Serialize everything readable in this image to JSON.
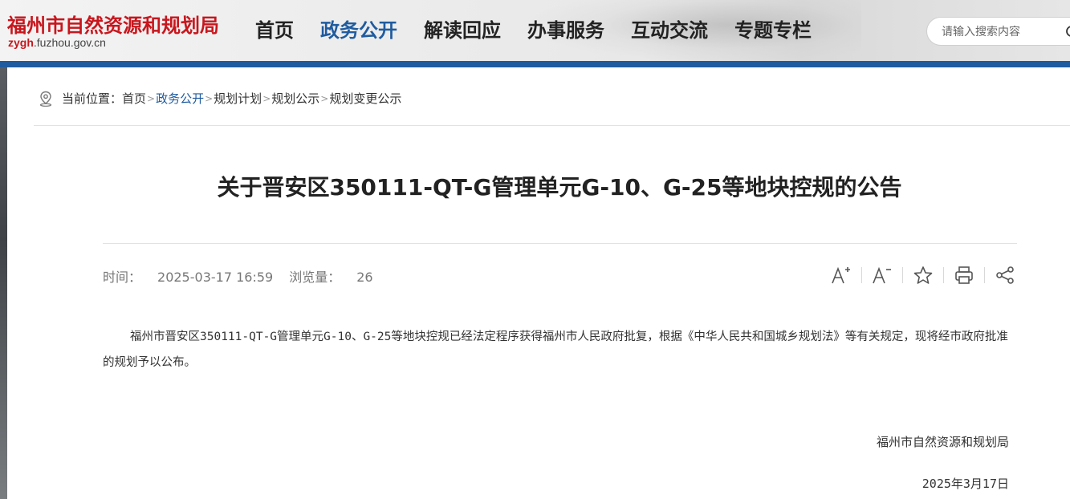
{
  "site": {
    "name_cn": "福州市自然资源和规划局",
    "domain_prefix": "zygh",
    "domain_suffix": ".fuzhou.gov.cn"
  },
  "nav": {
    "items": [
      {
        "label": "首页",
        "active": false
      },
      {
        "label": "政务公开",
        "active": true
      },
      {
        "label": "解读回应",
        "active": false
      },
      {
        "label": "办事服务",
        "active": false
      },
      {
        "label": "互动交流",
        "active": false
      },
      {
        "label": "专题专栏",
        "active": false
      }
    ]
  },
  "search": {
    "placeholder": "请输入搜索内容",
    "icon": "search-icon"
  },
  "breadcrumb": {
    "prefix": "当前位置：",
    "items": [
      {
        "label": "首页",
        "active": false
      },
      {
        "label": "政务公开",
        "active": true
      },
      {
        "label": "规划计划",
        "active": false
      },
      {
        "label": "规划公示",
        "active": false
      },
      {
        "label": "规划变更公示",
        "active": false
      }
    ],
    "separator": ">"
  },
  "article": {
    "title": "关于晋安区350111-QT-G管理单元G-10、G-25等地块控规的公告",
    "time_label": "时间：",
    "time": "2025-03-17 16:59",
    "views_label": "浏览量：",
    "views": "26",
    "body": "福州市晋安区350111-QT-G管理单元G-10、G-25等地块控规已经法定程序获得福州市人民政府批复，根据《中华人民共和国城乡规划法》等有关规定，现将经市政府批准的规划予以公布。",
    "sign_org": "福州市自然资源和规划局",
    "sign_date": "2025年3月17日"
  },
  "tools": [
    {
      "icon": "font-increase-icon"
    },
    {
      "icon": "font-decrease-icon"
    },
    {
      "icon": "favorite-star-icon"
    },
    {
      "icon": "print-icon"
    },
    {
      "icon": "share-icon"
    }
  ],
  "colors": {
    "brand_red": "#c8161d",
    "brand_blue": "#1f5b9f"
  }
}
